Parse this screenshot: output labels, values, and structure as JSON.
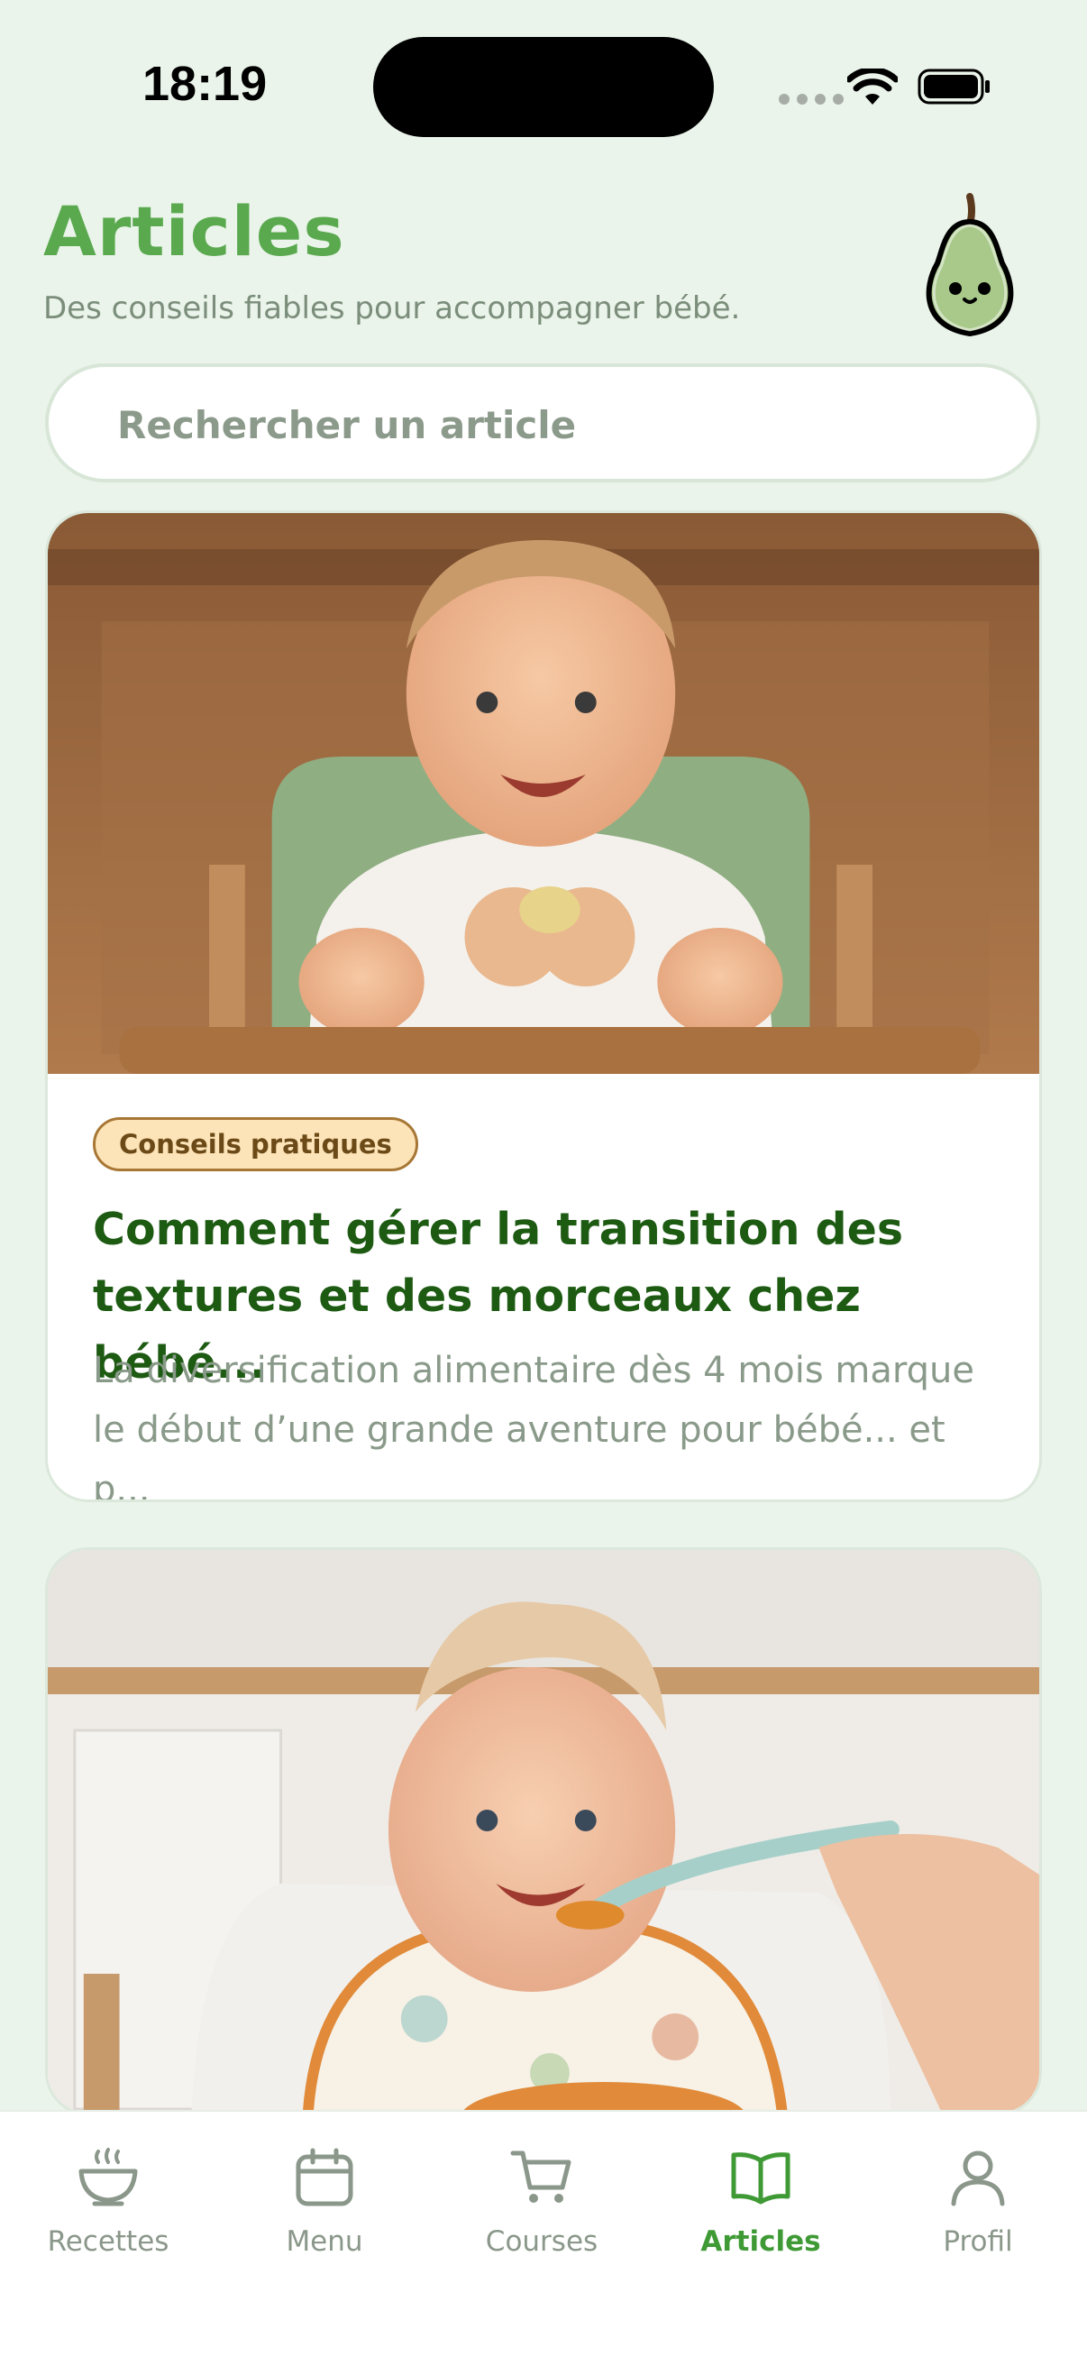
{
  "status_bar": {
    "time": "18:19"
  },
  "header": {
    "title": "Articles",
    "subtitle": "Des conseils fiables pour accompagner bébé.",
    "mascot_icon": "pear-mascot-icon"
  },
  "search": {
    "placeholder": "Rechercher un article",
    "value": ""
  },
  "articles": [
    {
      "tag": "Conseils pratiques",
      "title": "Comment gérer la transition des textures et des morceaux chez bébé...",
      "excerpt": "La diversification alimentaire dès 4 mois marque le début d’une grande aventure pour bébé... et p..."
    },
    {
      "tag": "",
      "title": "",
      "excerpt": ""
    }
  ],
  "tabbar": {
    "items": [
      {
        "label": "Recettes",
        "icon": "bowl-icon",
        "active": false
      },
      {
        "label": "Menu",
        "icon": "calendar-icon",
        "active": false
      },
      {
        "label": "Courses",
        "icon": "cart-icon",
        "active": false
      },
      {
        "label": "Articles",
        "icon": "book-icon",
        "active": true
      },
      {
        "label": "Profil",
        "icon": "user-icon",
        "active": false
      }
    ]
  },
  "colors": {
    "background": "#eaf4ea",
    "accent": "#5aa94f",
    "title_dark": "#1d5a12",
    "tag_bg": "#fde4b8",
    "tag_border": "#a77735"
  }
}
